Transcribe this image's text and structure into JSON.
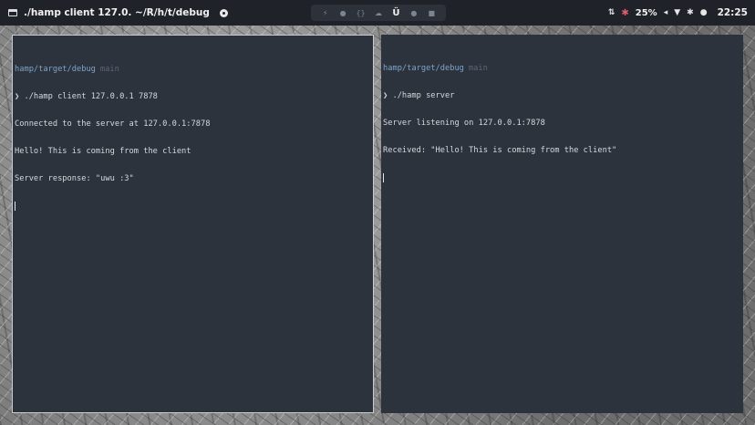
{
  "topbar": {
    "window_title": "./hamp client 127.0. ~/R/h/t/debug",
    "workspaces": [
      "⚡",
      "●",
      "{}",
      "☁",
      "Ü",
      "●",
      "■"
    ],
    "active_workspace": "Ü",
    "tray": {
      "battery_percent": "25%",
      "time": "22:25"
    }
  },
  "terminals": {
    "left": {
      "path": "hamp/target/debug",
      "branch": "main",
      "prompt_symbol": "❯",
      "command": "./hamp client 127.0.0.1 7878",
      "output": [
        "Connected to the server at 127.0.0.1:7878",
        "Hello! This is coming from the client",
        "Server response: \"uwu :3\""
      ]
    },
    "right": {
      "path": "hamp/target/debug",
      "branch": "main",
      "prompt_symbol": "❯",
      "command": "./hamp server",
      "output": [
        "Server listening on 127.0.0.1:7878",
        "Received: \"Hello! This is coming from the client\""
      ]
    }
  },
  "colors": {
    "terminal_bg": "#2d333d",
    "path": "#7ea3c8",
    "branch": "#5b6675",
    "battery": "#e05a6a"
  }
}
